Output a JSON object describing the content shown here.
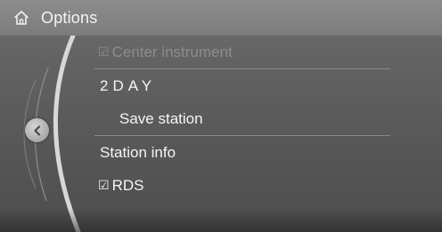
{
  "header": {
    "title": "Options",
    "icon": "home-icon"
  },
  "menu": {
    "items": [
      {
        "label": "Center instrument",
        "checkbox": true,
        "state": "disabled"
      },
      {
        "label": "2DAY",
        "state": "normal"
      },
      {
        "label": "Save station",
        "state": "normal"
      },
      {
        "label": "Station info",
        "state": "normal"
      },
      {
        "label": "RDS",
        "checkbox": true,
        "state": "normal"
      }
    ]
  },
  "controls": {
    "back_icon": "chevron-left-icon"
  },
  "colors": {
    "header_bg": "#858585",
    "panel_bg": "#5f5f5f",
    "text": "#f5f5f5",
    "disabled_text": "#8c8c8c",
    "divider": "#9a9a9a"
  }
}
